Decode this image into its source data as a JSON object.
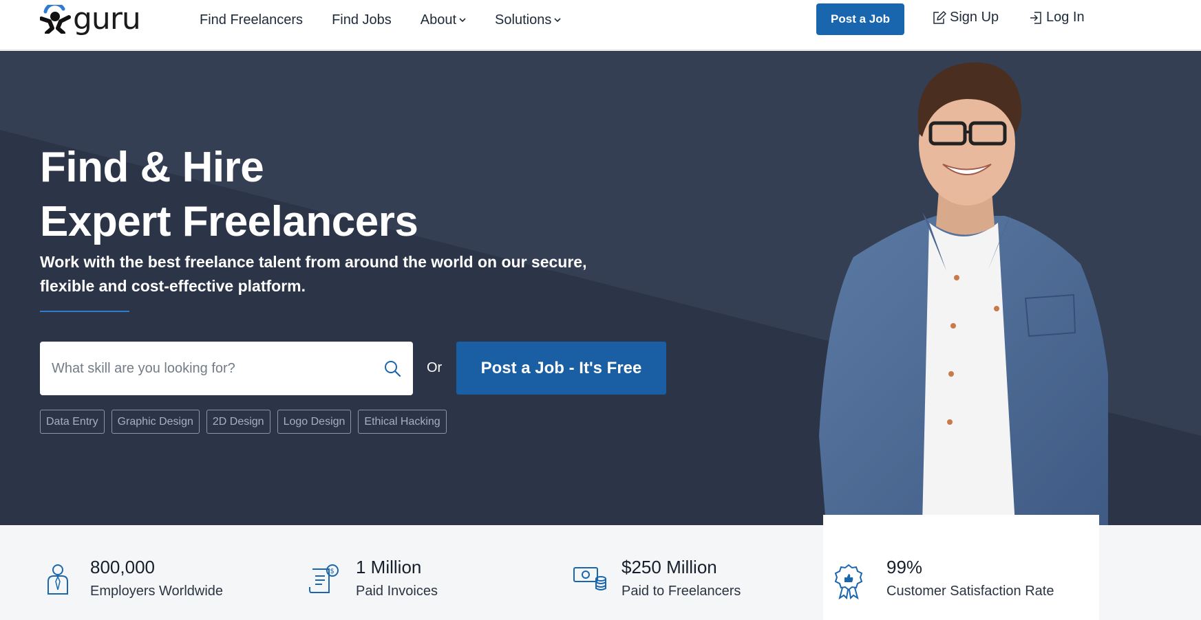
{
  "header": {
    "logo_text": "guru",
    "nav": [
      {
        "label": "Find Freelancers",
        "has_dropdown": false
      },
      {
        "label": "Find Jobs",
        "has_dropdown": false
      },
      {
        "label": "About",
        "has_dropdown": true
      },
      {
        "label": "Solutions",
        "has_dropdown": true
      }
    ],
    "post_job_label": "Post a Job",
    "signup_label": "Sign Up",
    "login_label": "Log In"
  },
  "hero": {
    "title_line1": "Find & Hire",
    "title_line2": "Expert Freelancers",
    "subtitle": "Work with the best freelance talent from around the world on our secure, flexible and cost-effective platform.",
    "search": {
      "placeholder": "What skill are you looking for?",
      "value": ""
    },
    "or_text": "Or",
    "post_job_label": "Post a Job - It's Free",
    "tags": [
      "Data Entry",
      "Graphic Design",
      "2D Design",
      "Logo Design",
      "Ethical Hacking"
    ]
  },
  "stats": [
    {
      "icon": "employer-icon",
      "value": "800,000",
      "label": "Employers Worldwide"
    },
    {
      "icon": "invoice-icon",
      "value": "1 Million",
      "label": "Paid Invoices"
    },
    {
      "icon": "money-icon",
      "value": "$250 Million",
      "label": "Paid to Freelancers"
    },
    {
      "icon": "award-icon",
      "value": "99%",
      "label": "Customer Satisfaction Rate"
    }
  ],
  "colors": {
    "brand_blue": "#1a66ae",
    "hero_bg": "#2c3548",
    "hero_bg_light": "#353f53",
    "accent_line": "#2f7bd1",
    "stats_bg": "#f5f6f7"
  }
}
